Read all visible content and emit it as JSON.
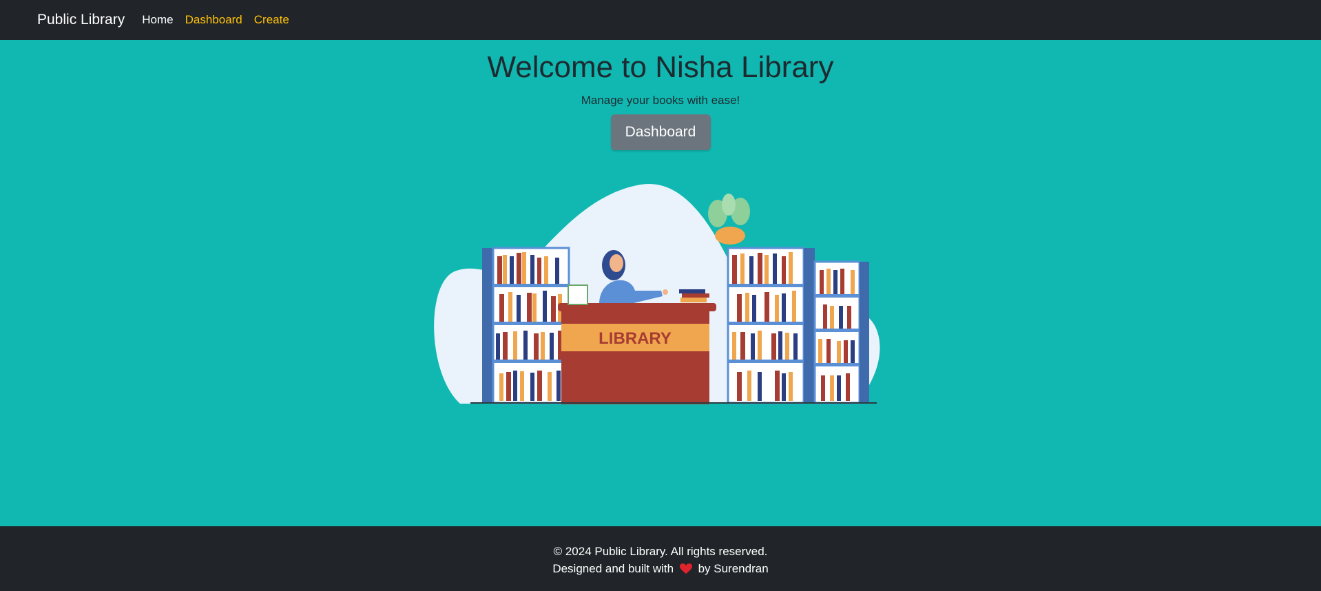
{
  "navbar": {
    "brand": "Public Library",
    "links": [
      {
        "label": "Home",
        "color": "#ffffff"
      },
      {
        "label": "Dashboard",
        "color": "#ffc107"
      },
      {
        "label": "Create",
        "color": "#ffc107"
      }
    ]
  },
  "hero": {
    "title": "Welcome to Nisha Library",
    "subtitle": "Manage your books with ease!",
    "button_label": "Dashboard"
  },
  "illustration": {
    "desk_sign": "LIBRARY"
  },
  "footer": {
    "copyright": "© 2024 Public Library. All rights reserved.",
    "credit_prefix": "Designed and built with",
    "credit_icon": "heart-icon",
    "credit_suffix": "by Surendran"
  },
  "colors": {
    "navbar_bg": "#212529",
    "page_bg": "#10b8b1",
    "button_bg": "#6c757d",
    "link_accent": "#ffc107"
  }
}
